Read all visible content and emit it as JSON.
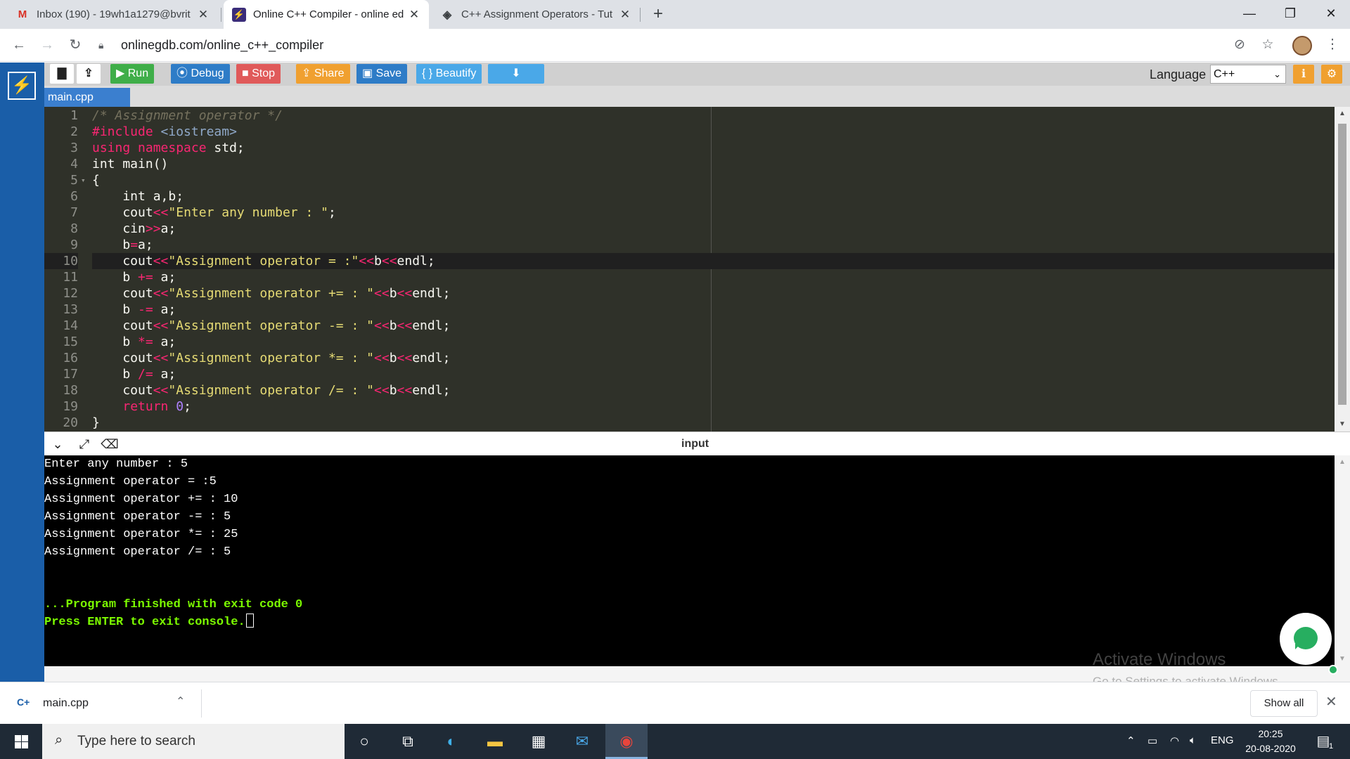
{
  "browser": {
    "tabs": [
      {
        "title": "Inbox (190) - 19wh1a1279@bvrit",
        "favicon": "gmail-icon",
        "active": false
      },
      {
        "title": "Online C++ Compiler - online ed",
        "favicon": "onlinegdb-icon",
        "active": true
      },
      {
        "title": "C++ Assignment Operators - Tut",
        "favicon": "tutorial-site-icon",
        "active": false
      }
    ],
    "url": "onlinegdb.com/online_c++_compiler"
  },
  "ide": {
    "toolbar": {
      "run": "Run",
      "debug": "Debug",
      "stop": "Stop",
      "share": "Share",
      "save": "Save",
      "beautify": "{ } Beautify",
      "language_label": "Language",
      "language_value": "C++"
    },
    "file_tab": "main.cpp",
    "colors": {
      "run": "#3fae49",
      "debug": "#2e7cc7",
      "stop": "#e05a5a",
      "share": "#f0a030",
      "save": "#2e7cc7",
      "beautify": "#4aa8e8",
      "download": "#4aa8e8"
    }
  },
  "editor": {
    "line_numbers": [
      "1",
      "2",
      "3",
      "4",
      "5",
      "6",
      "7",
      "8",
      "9",
      "10",
      "11",
      "12",
      "13",
      "14",
      "15",
      "16",
      "17",
      "18",
      "19",
      "20"
    ],
    "current_line": 10
  },
  "console": {
    "title": "input",
    "output": [
      "Enter any number : 5",
      "Assignment operator = :5",
      "Assignment operator += : 10",
      "Assignment operator -= : 5",
      "Assignment operator *= : 25",
      "Assignment operator /= : 5"
    ],
    "status_line_1": "...Program finished with exit code 0",
    "status_line_2": "Press ENTER to exit console."
  },
  "watermark": {
    "line1": "Activate Windows",
    "line2": "Go to Settings to activate Windows."
  },
  "download_shelf": {
    "file": "main.cpp",
    "show_all": "Show all"
  },
  "taskbar": {
    "search_placeholder": "Type here to search",
    "lang": "ENG",
    "time": "20:25",
    "date": "20-08-2020",
    "notifications": "1"
  }
}
